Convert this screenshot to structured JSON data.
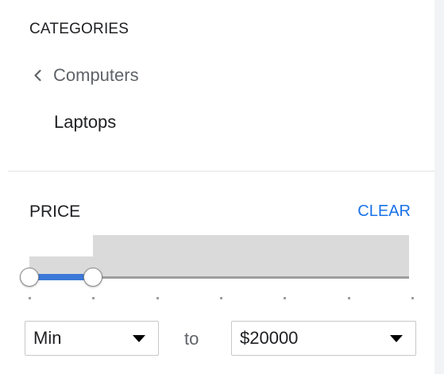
{
  "categories": {
    "heading": "CATEGORIES",
    "parent_label": "Computers",
    "current_label": "Laptops"
  },
  "price": {
    "heading": "PRICE",
    "clear_label": "CLEAR",
    "min_select": {
      "selected": "Min"
    },
    "to_label": "to",
    "max_select": {
      "selected": "$20000"
    },
    "slider": {
      "selected_range_fraction": [
        0.0,
        0.167
      ],
      "tick_count": 7,
      "accent_color": "#3c78d8",
      "track_color": "#9e9e9e",
      "histogram_color": "#dadada"
    },
    "histogram_levels": [
      0.5,
      1.0
    ]
  },
  "link_color": "#1a73e8"
}
